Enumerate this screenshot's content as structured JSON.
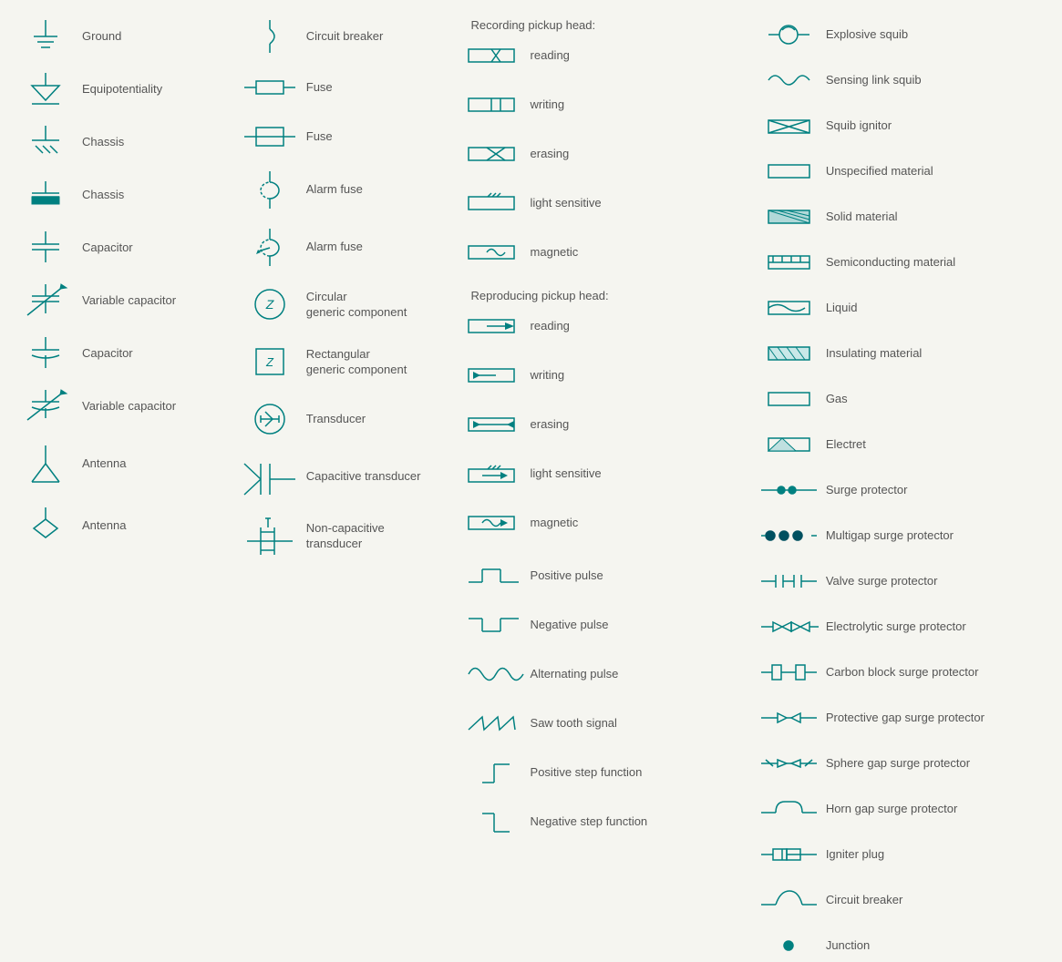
{
  "col1": {
    "items": [
      {
        "label": "Ground",
        "icon": "ground"
      },
      {
        "label": "Equipotentiality",
        "icon": "equipotentiality"
      },
      {
        "label": "Chassis",
        "icon": "chassis1"
      },
      {
        "label": "Chassis",
        "icon": "chassis2"
      },
      {
        "label": "Capacitor",
        "icon": "capacitor"
      },
      {
        "label": "Variable capacitor",
        "icon": "variable-capacitor"
      },
      {
        "label": "Capacitor",
        "icon": "capacitor2"
      },
      {
        "label": "Variable capacitor",
        "icon": "variable-capacitor2"
      },
      {
        "label": "Antenna",
        "icon": "antenna"
      },
      {
        "label": "Antenna",
        "icon": "antenna2"
      }
    ]
  },
  "col2": {
    "items": [
      {
        "label": "Circuit breaker",
        "icon": "circuit-breaker"
      },
      {
        "label": "Fuse",
        "icon": "fuse1"
      },
      {
        "label": "Fuse",
        "icon": "fuse2"
      },
      {
        "label": "Alarm fuse",
        "icon": "alarm-fuse1"
      },
      {
        "label": "Alarm fuse",
        "icon": "alarm-fuse2"
      },
      {
        "label": "Circular\ngeneric component",
        "icon": "circular-generic"
      },
      {
        "label": "Rectangular\ngeneric component",
        "icon": "rectangular-generic"
      },
      {
        "label": "Transducer",
        "icon": "transducer"
      },
      {
        "label": "Capacitive transducer",
        "icon": "capacitive-transducer"
      },
      {
        "label": "Non-capacitive\ntransducer",
        "icon": "non-capacitive-transducer"
      }
    ]
  },
  "col3": {
    "groups": [
      {
        "header": "Recording pickup head:",
        "items": [
          {
            "label": "reading",
            "icon": "rec-reading"
          },
          {
            "label": "writing",
            "icon": "rec-writing"
          },
          {
            "label": "erasing",
            "icon": "rec-erasing"
          },
          {
            "label": "light sensitive",
            "icon": "rec-light"
          },
          {
            "label": "magnetic",
            "icon": "rec-magnetic"
          }
        ]
      },
      {
        "header": "Reproducing pickup head:",
        "items": [
          {
            "label": "reading",
            "icon": "rep-reading"
          },
          {
            "label": "writing",
            "icon": "rep-writing"
          },
          {
            "label": "erasing",
            "icon": "rep-erasing"
          },
          {
            "label": "light sensitive",
            "icon": "rep-light"
          },
          {
            "label": "magnetic",
            "icon": "rep-magnetic"
          }
        ]
      },
      {
        "singles": [
          {
            "label": "Positive pulse",
            "icon": "pos-pulse"
          },
          {
            "label": "Negative pulse",
            "icon": "neg-pulse"
          },
          {
            "label": "Alternating pulse",
            "icon": "alt-pulse"
          },
          {
            "label": "Saw tooth signal",
            "icon": "saw-tooth"
          },
          {
            "label": "Positive step function",
            "icon": "pos-step"
          },
          {
            "label": "Negative step function",
            "icon": "neg-step"
          }
        ]
      }
    ]
  },
  "col4": {
    "items": [
      {
        "label": "Explosive squib",
        "icon": "explosive-squib"
      },
      {
        "label": "Sensing link squib",
        "icon": "sensing-squib"
      },
      {
        "label": "Squib ignitor",
        "icon": "squib-ignitor"
      },
      {
        "label": "Unspecified material",
        "icon": "unspecified-material"
      },
      {
        "label": "Solid material",
        "icon": "solid-material"
      },
      {
        "label": "Semiconducting material",
        "icon": "semiconducting-material"
      },
      {
        "label": "Liquid",
        "icon": "liquid"
      },
      {
        "label": "Insulating material",
        "icon": "insulating-material"
      },
      {
        "label": "Gas",
        "icon": "gas"
      },
      {
        "label": "Electret",
        "icon": "electret"
      },
      {
        "label": "Surge protector",
        "icon": "surge-protector"
      },
      {
        "label": "Multigap surge protector",
        "icon": "multigap-surge"
      },
      {
        "label": "Valve surge protector",
        "icon": "valve-surge"
      },
      {
        "label": "Electrolytic surge protector",
        "icon": "electrolytic-surge"
      },
      {
        "label": "Carbon block surge protector",
        "icon": "carbon-block-surge"
      },
      {
        "label": "Protective gap surge protector",
        "icon": "protective-gap-surge"
      },
      {
        "label": "Sphere gap surge protector",
        "icon": "sphere-gap-surge"
      },
      {
        "label": "Horn gap surge protector",
        "icon": "horn-gap-surge"
      },
      {
        "label": "Igniter plug",
        "icon": "igniter-plug"
      },
      {
        "label": "Circuit breaker",
        "icon": "circuit-breaker-col4"
      },
      {
        "label": "Junction",
        "icon": "junction"
      }
    ]
  }
}
